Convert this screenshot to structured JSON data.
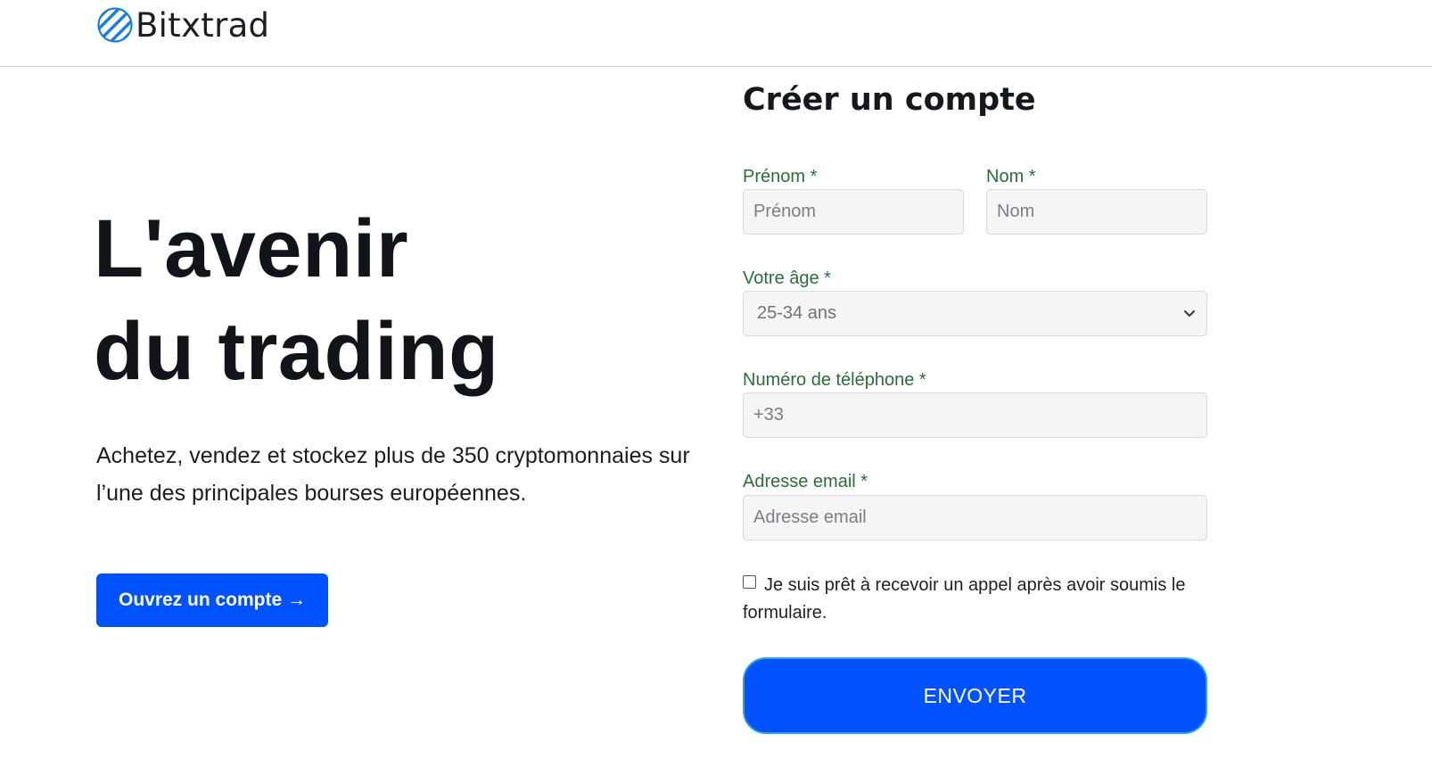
{
  "header": {
    "brand_name": "Bitxtrad",
    "logo_icon": "striped-globe-logo"
  },
  "hero": {
    "title_line1": "L'avenir",
    "title_line2": "du trading",
    "description": "Achetez, vendez et stockez plus de 350 cryptomonnaies sur l’une des principales bourses européennes.",
    "cta_label": "Ouvrez un compte →"
  },
  "form": {
    "title": "Créer un compte",
    "first_name": {
      "label": "Prénom *",
      "placeholder": "Prénom",
      "value": ""
    },
    "last_name": {
      "label": "Nom *",
      "placeholder": "Nom",
      "value": ""
    },
    "age": {
      "label": "Votre âge *",
      "selected": "25-34 ans"
    },
    "phone": {
      "label": "Numéro de téléphone *",
      "placeholder": "+33",
      "value": ""
    },
    "email": {
      "label": "Adresse email *",
      "placeholder": "Adresse email",
      "value": ""
    },
    "consent": {
      "checked": false,
      "label": "Je suis prêt à recevoir un appel après avoir soumis le formulaire."
    },
    "submit_label": "ENVOYER"
  },
  "colors": {
    "primary": "#0052ff",
    "label_green": "#2e6b3b",
    "logo_blue": "#1e7fd6",
    "submit_border": "#2fa3e0"
  }
}
